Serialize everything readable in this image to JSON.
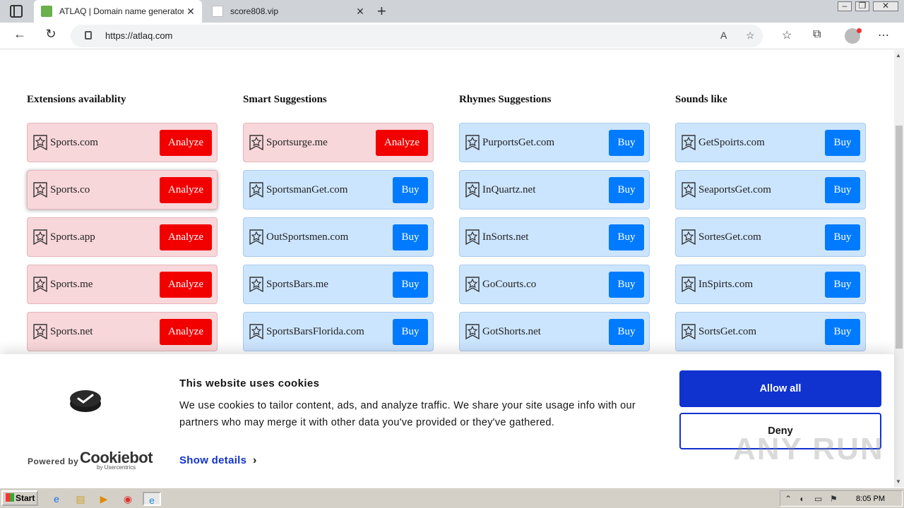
{
  "browser": {
    "tabs": [
      {
        "title": "ATLAQ | Domain name generator",
        "active": true
      },
      {
        "title": "score808.vip",
        "active": false
      }
    ],
    "url": "https://atlaq.com"
  },
  "columns": [
    {
      "title": "Extensions availablity",
      "items": [
        {
          "domain": "Sports.com",
          "action": "Analyze"
        },
        {
          "domain": "Sports.co",
          "action": "Analyze"
        },
        {
          "domain": "Sports.app",
          "action": "Analyze"
        },
        {
          "domain": "Sports.me",
          "action": "Analyze"
        },
        {
          "domain": "Sports.net",
          "action": "Analyze"
        }
      ]
    },
    {
      "title": "Smart Suggestions",
      "items": [
        {
          "domain": "Sportsurge.me",
          "action": "Analyze"
        },
        {
          "domain": "SportsmanGet.com",
          "action": "Buy"
        },
        {
          "domain": "OutSportsmen.com",
          "action": "Buy"
        },
        {
          "domain": "SportsBars.me",
          "action": "Buy"
        },
        {
          "domain": "SportsBarsFlorida.com",
          "action": "Buy"
        }
      ]
    },
    {
      "title": "Rhymes Suggestions",
      "items": [
        {
          "domain": "PurportsGet.com",
          "action": "Buy"
        },
        {
          "domain": "InQuartz.net",
          "action": "Buy"
        },
        {
          "domain": "InSorts.net",
          "action": "Buy"
        },
        {
          "domain": "GoCourts.co",
          "action": "Buy"
        },
        {
          "domain": "GotShorts.net",
          "action": "Buy"
        }
      ]
    },
    {
      "title": "Sounds like",
      "items": [
        {
          "domain": "GetSpoirts.com",
          "action": "Buy"
        },
        {
          "domain": "SeaportsGet.com",
          "action": "Buy"
        },
        {
          "domain": "SortesGet.com",
          "action": "Buy"
        },
        {
          "domain": "InSpirts.com",
          "action": "Buy"
        },
        {
          "domain": "SortsGet.com",
          "action": "Buy"
        }
      ]
    }
  ],
  "cookie_banner": {
    "title": "This website uses cookies",
    "text": "We use cookies to tailor content, ads, and analyze traffic. We share your site usage info with our partners who may merge it with other data you've provided or they've gathered.",
    "show_details": "Show details",
    "allow_all": "Allow all",
    "deny": "Deny",
    "powered_by": "Powered by",
    "cookiebot": "Cookiebot",
    "cookiebot_sub": "by Usercentrics"
  },
  "watermark": "ANY RUN",
  "taskbar": {
    "start": "Start",
    "clock": "8:05 PM"
  },
  "colors": {
    "analyze_red": "#f20000",
    "buy_blue": "#007bff",
    "cookie_blue": "#1032cf"
  }
}
